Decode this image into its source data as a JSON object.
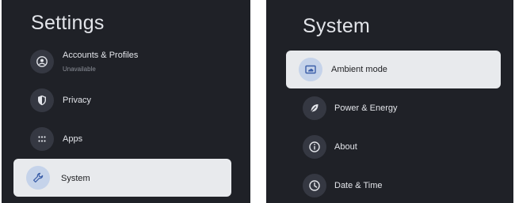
{
  "left": {
    "title": "Settings",
    "items": [
      {
        "label": "Accounts & Profiles",
        "sublabel": "Unavailable",
        "icon": "account-icon"
      },
      {
        "label": "Privacy",
        "icon": "shield-icon"
      },
      {
        "label": "Apps",
        "icon": "apps-grid-icon"
      },
      {
        "label": "System",
        "icon": "wrench-icon",
        "selected": true
      }
    ]
  },
  "right": {
    "title": "System",
    "items": [
      {
        "label": "Ambient mode",
        "icon": "ambient-mode-icon",
        "selected": true
      },
      {
        "label": "Power & Energy",
        "icon": "leaf-icon"
      },
      {
        "label": "About",
        "icon": "info-icon"
      },
      {
        "label": "Date & Time",
        "icon": "clock-icon"
      }
    ]
  },
  "colors": {
    "background": "#1f2127",
    "selected_item": "#e8eaed",
    "icon_circle": "#353842",
    "selected_icon_circle": "#c5d3ea",
    "text": "#e3e5ea",
    "accent_icon": "#3b5ea8"
  }
}
